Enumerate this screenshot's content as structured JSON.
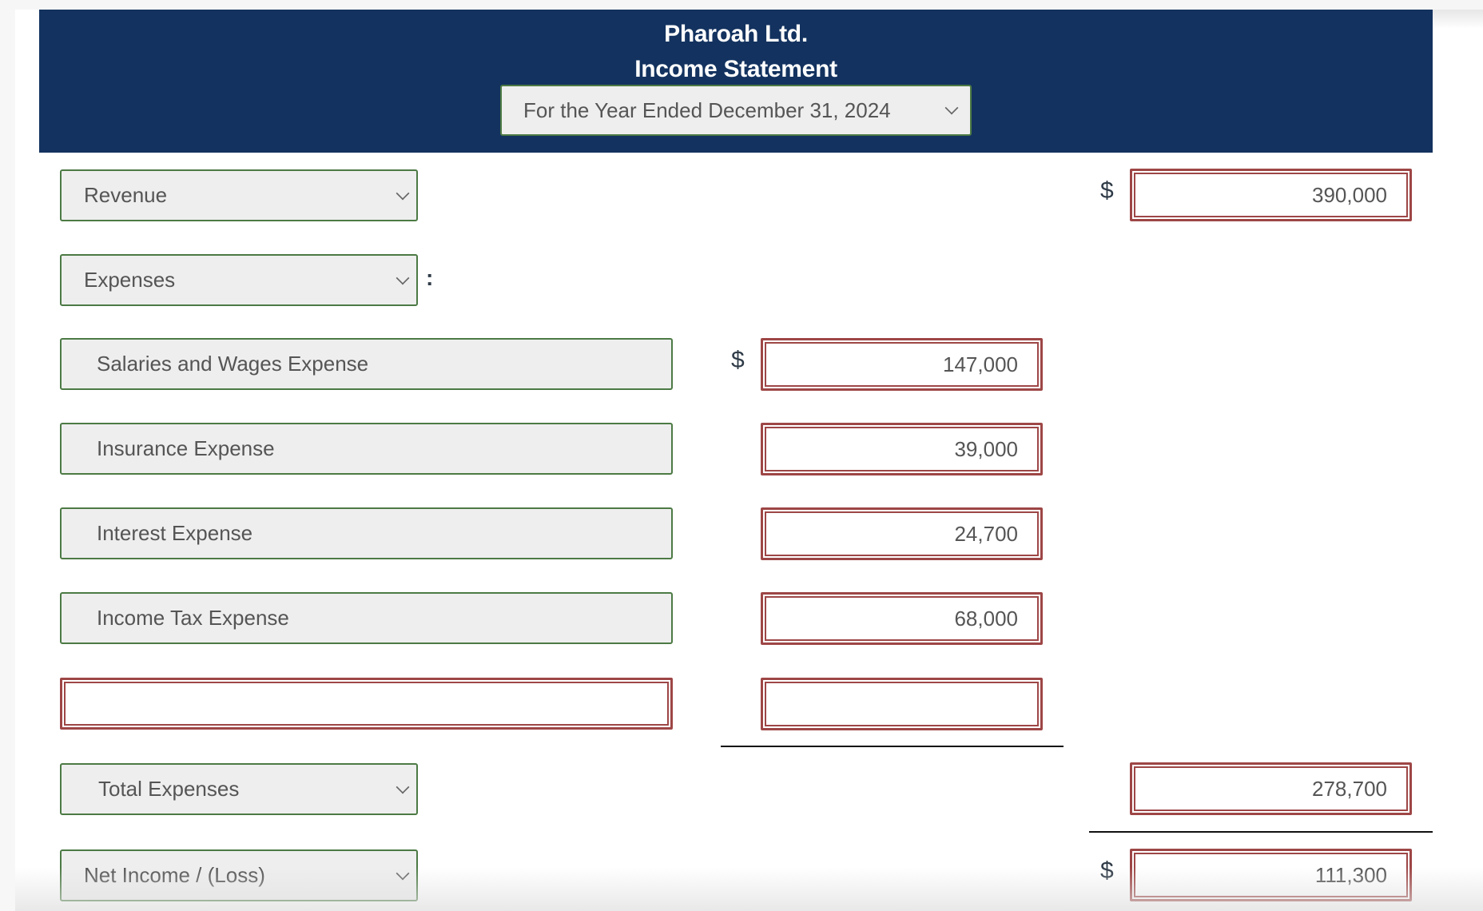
{
  "header": {
    "company": "Pharoah Ltd.",
    "statement": "Income Statement",
    "period": "For the Year Ended December 31, 2024"
  },
  "colors": {
    "header_bg": "#13325f",
    "select_border": "#4c7a44",
    "input_border": "#9e4646"
  },
  "currency_symbol": "$",
  "sections": {
    "revenue": {
      "label": "Revenue",
      "amount": "390,000"
    },
    "expenses": {
      "label": "Expenses",
      "suffix": ":"
    },
    "expense_items": [
      {
        "account": "Salaries and Wages Expense",
        "amount": "147,000"
      },
      {
        "account": "Insurance Expense",
        "amount": "39,000"
      },
      {
        "account": "Interest Expense",
        "amount": "24,700"
      },
      {
        "account": "Income Tax Expense",
        "amount": "68,000"
      },
      {
        "account": "",
        "amount": ""
      }
    ],
    "total_expenses": {
      "label": "Total Expenses",
      "amount": "278,700"
    },
    "net_income": {
      "label": "Net Income / (Loss)",
      "amount": "111,300"
    }
  }
}
